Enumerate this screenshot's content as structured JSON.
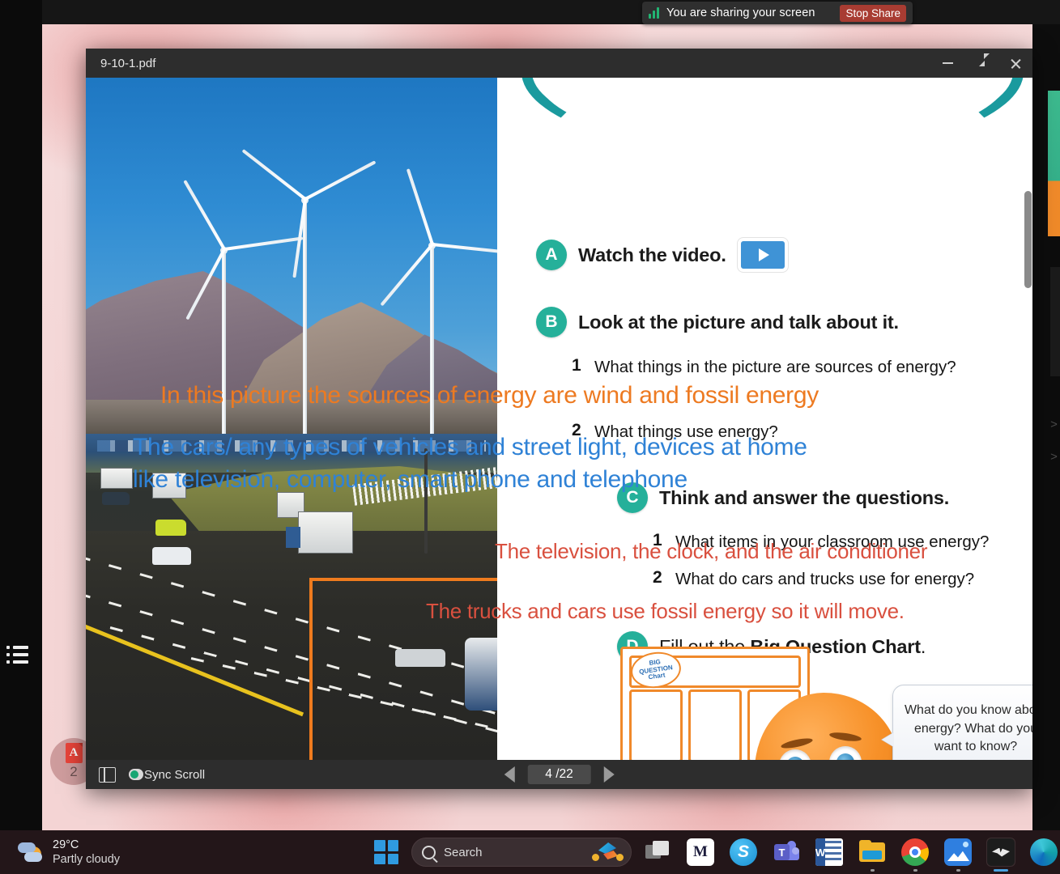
{
  "share_banner": {
    "icon": "signal-bars-icon",
    "message": "You are sharing your screen",
    "stop_label": "Stop Share"
  },
  "pdf_window": {
    "title": "9-10-1.pdf",
    "controls": {
      "minimize": "minimize-icon",
      "restore": "restore-icon",
      "close": "close-icon"
    },
    "toolbar": {
      "panel_toggle": "side-panel-icon",
      "sync_scroll_label": "Sync Scroll",
      "prev_label": "prev-page-icon",
      "next_label": "next-page-icon",
      "page_current": "4",
      "page_total": "/22"
    }
  },
  "dock": {
    "pdf_badge_letter": "A",
    "pdf_badge_count": "2",
    "list_icon": "list-icon"
  },
  "lesson": {
    "tasks": [
      {
        "letter": "A",
        "text": "Watch the video.",
        "has_video_chip": true
      },
      {
        "letter": "B",
        "text": "Look at the picture and talk about it.",
        "has_video_chip": false
      },
      {
        "letter": "C",
        "text": "Think and answer the questions.",
        "has_video_chip": false
      },
      {
        "letter": "D",
        "text_plain": "Fill out the ",
        "text_bold": "Big Question Chart",
        "text_tail": ".",
        "has_video_chip": false
      }
    ],
    "section_b_questions": [
      {
        "num": "1",
        "text": "What things in the picture are sources of energy?"
      },
      {
        "num": "2",
        "text": "What things use energy?"
      }
    ],
    "section_c_questions": [
      {
        "num": "1",
        "text": "What items in your classroom use energy?"
      },
      {
        "num": "2",
        "text": "What do cars and trucks use for energy?"
      }
    ],
    "big_question_chart": {
      "logo_line1": "BIG",
      "logo_line2": "QUESTION",
      "logo_line3": "Chart"
    },
    "speech_bubble": "What do you know about energy? What do you want to know?"
  },
  "annotations": [
    {
      "text": "In this picture the sources of energy are wind and fossil energy",
      "color": "#ed7a21",
      "style": "orange"
    },
    {
      "text": "The cars/ any types of vehicles and street light, devices at home",
      "color": "#2f82d6",
      "style": "blue"
    },
    {
      "text": "like television, computer, smart phone and telephone",
      "color": "#2f82d6",
      "style": "blue"
    },
    {
      "text": "The television, the clock,  and the air conditioner",
      "color": "#d9503f",
      "style": "red"
    },
    {
      "text": "The trucks and cars use fossil energy so it will move.",
      "color": "#d9503f",
      "style": "red"
    }
  ],
  "taskbar": {
    "weather": {
      "icon": "partly-cloudy-icon",
      "temperature": "29°C",
      "condition": "Partly cloudy"
    },
    "start": "windows-start-icon",
    "search": {
      "icon": "search-icon",
      "placeholder": "Search",
      "decor_icon": "bird-icon"
    },
    "apps": [
      {
        "name": "task-view-icon"
      },
      {
        "name": "app-m-icon"
      },
      {
        "name": "skype-icon",
        "letter": "S"
      },
      {
        "name": "teams-icon",
        "letter": "T"
      },
      {
        "name": "word-icon",
        "letter": "W"
      },
      {
        "name": "file-explorer-icon"
      },
      {
        "name": "chrome-icon"
      },
      {
        "name": "photos-icon"
      },
      {
        "name": "screen-share-app-icon"
      },
      {
        "name": "edge-icon"
      }
    ]
  },
  "colors": {
    "accent_teal": "#25b09a",
    "annotation_orange": "#ed7a21",
    "annotation_blue": "#2f82d6",
    "annotation_red": "#d9503f",
    "highlight_box": "#ef7b1e",
    "stop_share_red": "#a83c32"
  }
}
